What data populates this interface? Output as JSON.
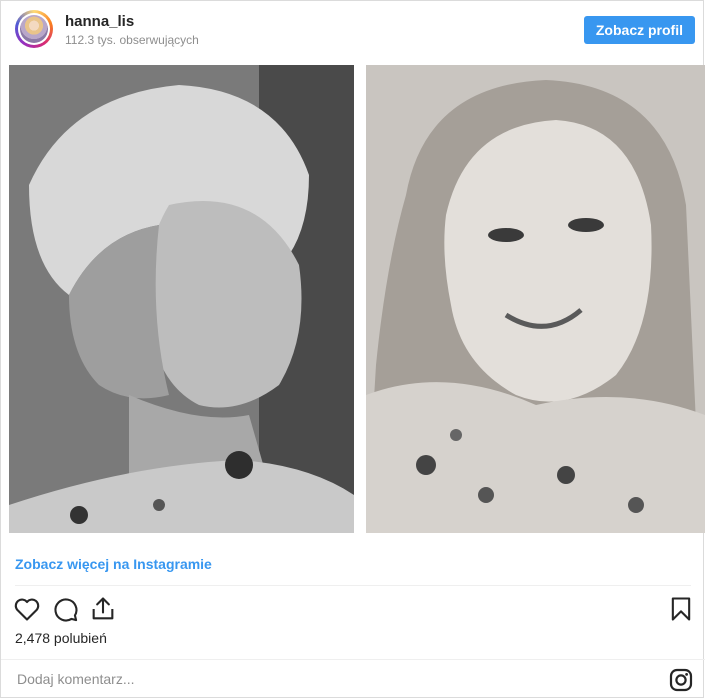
{
  "header": {
    "username": "hanna_lis",
    "followers": "112.3 tys. obserwujących",
    "profile_button": "Zobacz profil"
  },
  "post": {
    "see_more_link": "Zobacz więcej na Instagramie",
    "likes_text": "2,478 polubień"
  },
  "comment": {
    "placeholder": "Dodaj komentarz..."
  },
  "icons": [
    "heart-icon",
    "comment-icon",
    "share-icon",
    "bookmark-icon",
    "instagram-logo-icon"
  ],
  "colors": {
    "accent": "#3897f0",
    "text": "#262626",
    "muted": "#8e8e8e",
    "border": "#dbdbdb"
  }
}
